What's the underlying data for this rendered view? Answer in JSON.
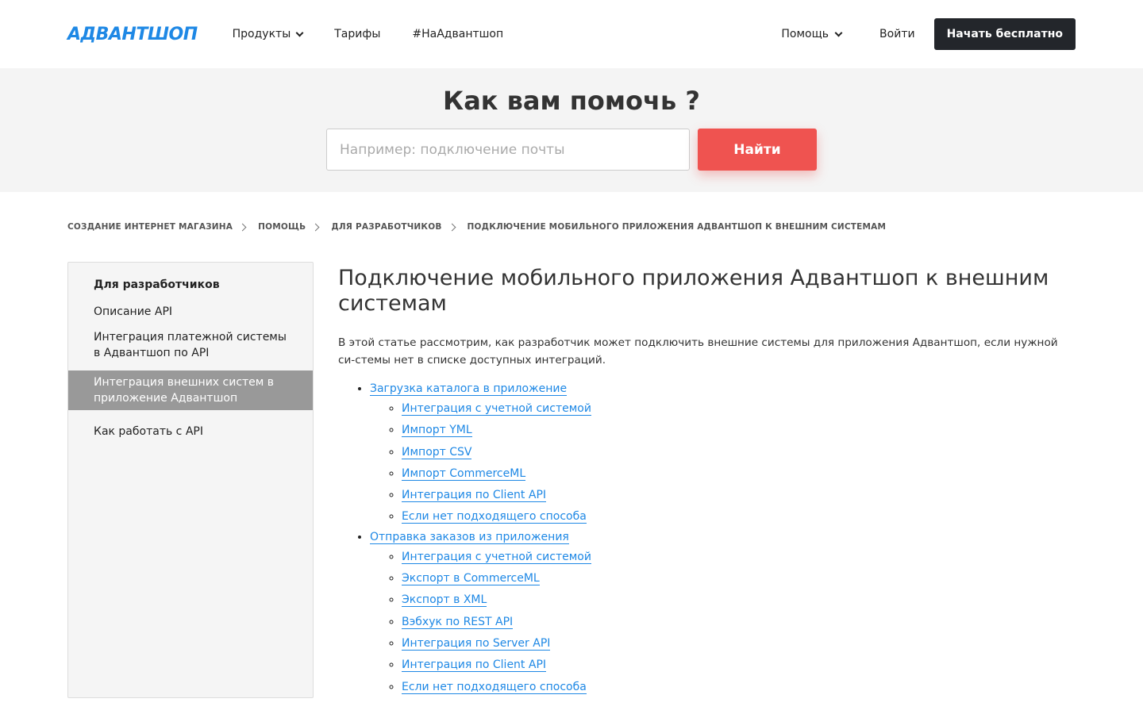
{
  "header": {
    "logo": "АДВАНТШОП",
    "nav": [
      {
        "label": "Продукты",
        "has_dropdown": true
      },
      {
        "label": "Тарифы",
        "has_dropdown": false
      },
      {
        "label": "#НаАдвантшоп",
        "has_dropdown": false
      }
    ],
    "help": "Помощь",
    "login": "Войти",
    "start": "Начать бесплатно"
  },
  "hero": {
    "title": "Как вам помочь ?",
    "search_placeholder": "Например: подключение почты",
    "search_button": "Найти"
  },
  "breadcrumb": [
    "СОЗДАНИЕ ИНТЕРНЕТ МАГАЗИНА",
    "ПОМОЩЬ",
    "ДЛЯ РАЗРАБОТЧИКОВ",
    "ПОДКЛЮЧЕНИЕ МОБИЛЬНОГО ПРИЛОЖЕНИЯ АДВАНТШОП К ВНЕШНИМ СИСТЕМАМ"
  ],
  "sidebar": {
    "title": "Для разработчиков",
    "items": [
      {
        "label": "Описание API",
        "active": false
      },
      {
        "label": "Интеграция платежной системы в Адвантшоп по API",
        "active": false
      },
      {
        "label": "Интеграция внешних систем в приложение Адвантшоп",
        "active": true
      },
      {
        "label": "Как работать с API",
        "active": false
      }
    ]
  },
  "article": {
    "title": "Подключение мобильного приложения Адвантшоп к внешним системам",
    "intro": "В этой статье рассмотрим, как разработчик может подключить внешние системы для приложения Адвантшоп, если нужной си-стемы нет в списке доступных интеграций.",
    "toc": [
      {
        "label": "Загрузка каталога в приложение",
        "children": [
          "Интеграция с учетной системой",
          "Импорт YML",
          "Импорт CSV",
          "Импорт CommerceML",
          "Интеграция по Client API",
          "Если нет подходящего способа"
        ]
      },
      {
        "label": "Отправка заказов из приложения",
        "children": [
          "Интеграция с учетной системой",
          "Экспорт в CommerceML",
          "Экспорт в XML",
          "Вэбхук по REST API",
          "Интеграция по Server API",
          "Интеграция по Client API",
          "Если нет подходящего способа"
        ]
      }
    ]
  },
  "colors": {
    "brand": "#1e88e5",
    "accent": "#ef5350",
    "dark_button": "#23262b",
    "active_sidebar": "#999999"
  }
}
